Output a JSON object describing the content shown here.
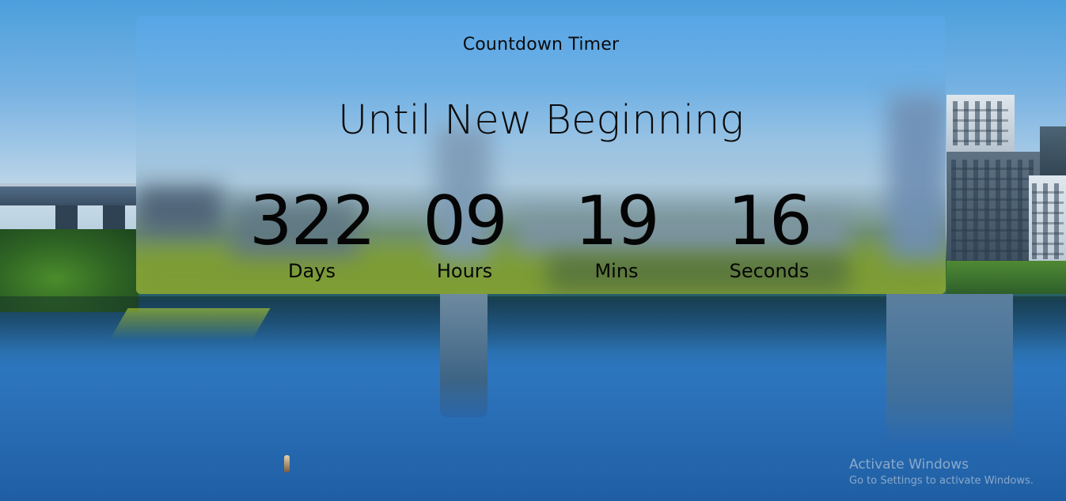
{
  "card": {
    "title": "Countdown Timer",
    "headline": "Until New Beginning"
  },
  "countdown": {
    "days": {
      "value": "322",
      "label": "Days"
    },
    "hours": {
      "value": "09",
      "label": "Hours"
    },
    "mins": {
      "value": "19",
      "label": "Mins"
    },
    "seconds": {
      "value": "16",
      "label": "Seconds"
    }
  },
  "watermark": {
    "title": "Activate Windows",
    "subtitle": "Go to Settings to activate Windows."
  },
  "colors": {
    "text": "#0b0b0b",
    "sky": "#4b9fdc",
    "water": "#2a6fb7"
  }
}
